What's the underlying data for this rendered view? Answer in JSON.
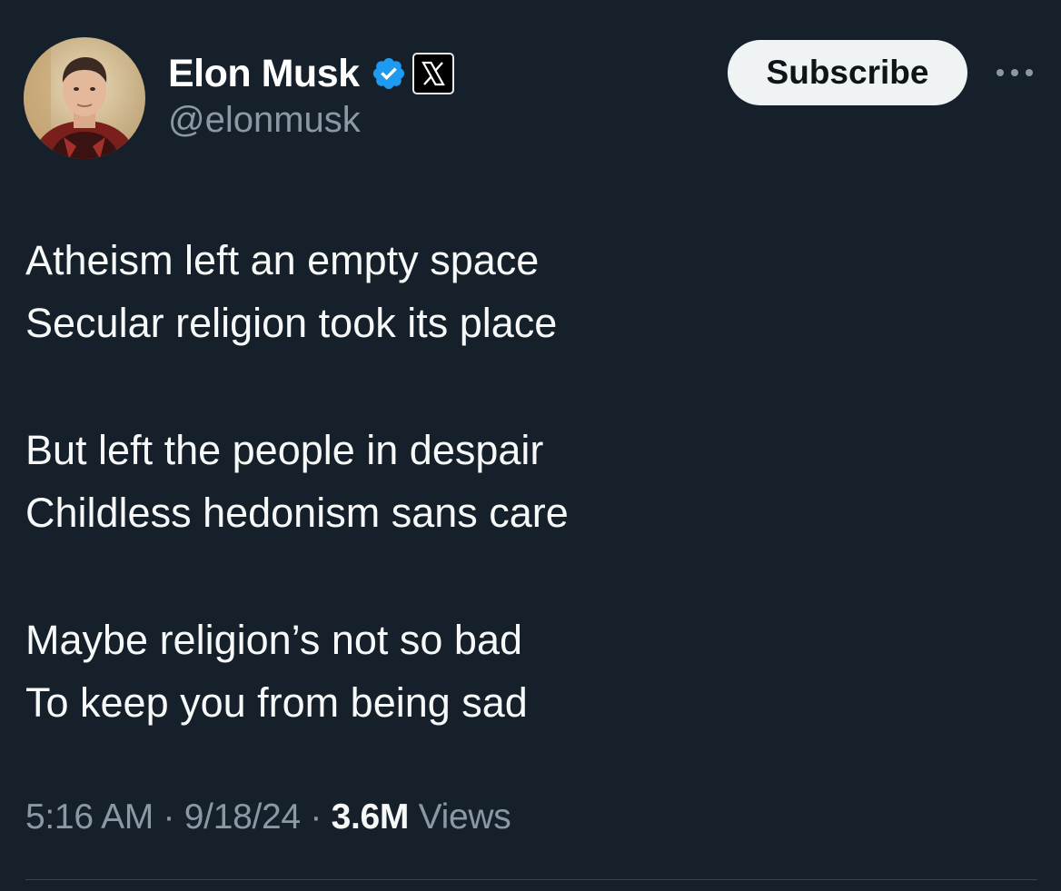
{
  "author": {
    "display_name": "Elon Musk",
    "handle": "@elonmusk",
    "verified_icon": "verified-badge-icon",
    "affiliate_icon": "x-logo-icon"
  },
  "actions": {
    "subscribe_label": "Subscribe",
    "more_icon": "more-horizontal-icon"
  },
  "tweet": {
    "stanzas": [
      {
        "lines": [
          "Atheism left an empty space",
          "Secular religion took its place"
        ]
      },
      {
        "lines": [
          "But left the people in despair",
          "Childless hedonism sans care"
        ]
      },
      {
        "lines": [
          "Maybe religion’s not so bad",
          "To keep you from being sad"
        ]
      }
    ],
    "time": "5:16 AM",
    "date": "9/18/24",
    "separator": "·",
    "views_count": "3.6M",
    "views_label": "Views"
  },
  "colors": {
    "background": "#16202a",
    "text_primary": "#f7f9f9",
    "text_secondary": "#8b98a5",
    "verified_blue": "#1d9bf0",
    "subscribe_bg": "#eff3f4",
    "divider": "#38444d"
  }
}
